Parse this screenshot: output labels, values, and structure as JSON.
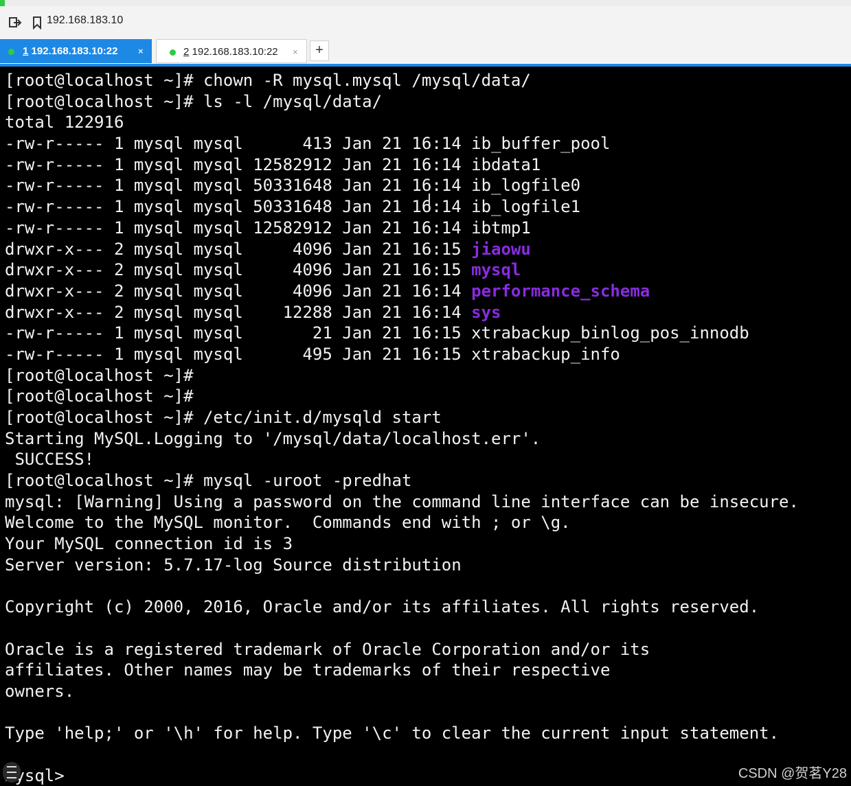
{
  "window": {
    "address": "192.168.183.10"
  },
  "tabs": [
    {
      "number": "1",
      "label": "192.168.183.10:22",
      "active": true,
      "close": "×"
    },
    {
      "number": "2",
      "label": "192.168.183.10:22",
      "active": false,
      "close": "×"
    }
  ],
  "tab_add_label": "+",
  "colors": {
    "accent": "#1e88e5",
    "status_dot": "#2ecc40",
    "terminal_bg": "#000000",
    "terminal_fg": "#f2f2f2",
    "directory": "#8a2be2"
  },
  "icons": {
    "nav": "exit-arrow-icon",
    "bookmark": "bookmark-icon",
    "menu": "menu-lines-icon"
  },
  "terminal": {
    "lines": [
      {
        "text": "[root@localhost ~]# chown -R mysql.mysql /mysql/data/"
      },
      {
        "text": "[root@localhost ~]# ls -l /mysql/data/"
      },
      {
        "text": "total 122916"
      },
      {
        "text": "-rw-r----- 1 mysql mysql      413 Jan 21 16:14 ",
        "name": "ib_buffer_pool"
      },
      {
        "text": "-rw-r----- 1 mysql mysql 12582912 Jan 21 16:14 ",
        "name": "ibdata1"
      },
      {
        "text": "-rw-r----- 1 mysql mysql 50331648 Jan 21 16:14 ",
        "name": "ib_logfile0"
      },
      {
        "text": "-rw-r----- 1 mysql mysql 50331648 Jan 21 16:14 ",
        "name": "ib_logfile1"
      },
      {
        "text": "-rw-r----- 1 mysql mysql 12582912 Jan 21 16:14 ",
        "name": "ibtmp1"
      },
      {
        "text": "drwxr-x--- 2 mysql mysql     4096 Jan 21 16:15 ",
        "dir": "jiaowu"
      },
      {
        "text": "drwxr-x--- 2 mysql mysql     4096 Jan 21 16:15 ",
        "dir": "mysql"
      },
      {
        "text": "drwxr-x--- 2 mysql mysql     4096 Jan 21 16:14 ",
        "dir": "performance_schema"
      },
      {
        "text": "drwxr-x--- 2 mysql mysql    12288 Jan 21 16:14 ",
        "dir": "sys"
      },
      {
        "text": "-rw-r----- 1 mysql mysql       21 Jan 21 16:15 ",
        "name": "xtrabackup_binlog_pos_innodb"
      },
      {
        "text": "-rw-r----- 1 mysql mysql      495 Jan 21 16:15 ",
        "name": "xtrabackup_info"
      },
      {
        "text": "[root@localhost ~]#"
      },
      {
        "text": "[root@localhost ~]#"
      },
      {
        "text": "[root@localhost ~]# /etc/init.d/mysqld start"
      },
      {
        "text": "Starting MySQL.Logging to '/mysql/data/localhost.err'."
      },
      {
        "text": " SUCCESS!"
      },
      {
        "text": "[root@localhost ~]# mysql -uroot -predhat"
      },
      {
        "text": "mysql: [Warning] Using a password on the command line interface can be insecure."
      },
      {
        "text": "Welcome to the MySQL monitor.  Commands end with ; or \\g."
      },
      {
        "text": "Your MySQL connection id is 3"
      },
      {
        "text": "Server version: 5.7.17-log Source distribution"
      },
      {
        "text": ""
      },
      {
        "text": "Copyright (c) 2000, 2016, Oracle and/or its affiliates. All rights reserved."
      },
      {
        "text": ""
      },
      {
        "text": "Oracle is a registered trademark of Oracle Corporation and/or its"
      },
      {
        "text": "affiliates. Other names may be trademarks of their respective"
      },
      {
        "text": "owners."
      },
      {
        "text": ""
      },
      {
        "text": "Type 'help;' or '\\h' for help. Type '\\c' to clear the current input statement."
      },
      {
        "text": ""
      },
      {
        "text": "mysql>"
      }
    ]
  },
  "watermark": "CSDN @贺茗Y28"
}
